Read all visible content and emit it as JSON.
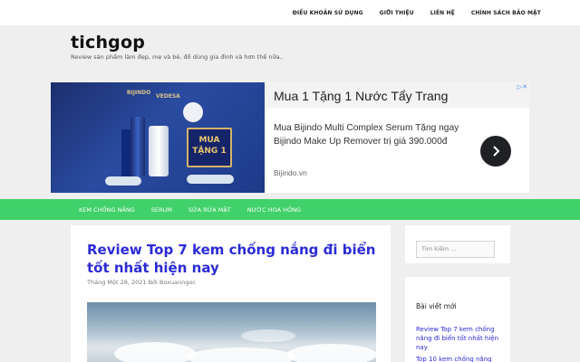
{
  "topbar": {
    "links": [
      "ĐIỀU KHOẢN SỬ DỤNG",
      "GIỚI THIỆU",
      "LIÊN HỆ",
      "CHÍNH SÁCH BẢO MẬT"
    ]
  },
  "site": {
    "title": "tichgop",
    "description": "Review sản phẩm làm đẹp, mẹ và bé, đồ dùng gia đình và hơn thế nữa.."
  },
  "ad": {
    "image_brand_left": "BIJINDO",
    "image_brand_right": "VEDESA",
    "image_promo": "MUA TẶNG 1",
    "headline": "Mua 1 Tặng 1 Nước Tẩy Trang",
    "body": "Mua Bijindo Multi Complex Serum Tặng ngay Bijindo Make Up Remover trị giá 390.000đ",
    "source": "Bijindo.vn",
    "next_icon": "chevron-right-icon",
    "close_icon": "adchoices-close-icon"
  },
  "nav": {
    "items": [
      "KEM CHỐNG NẮNG",
      "SERUM",
      "SỮA RỬA MẶT",
      "NƯỚC HOA HỒNG"
    ]
  },
  "article": {
    "title": "Review Top 7 kem chống nắng đi biển tốt nhất hiện nay",
    "meta": "Tháng Một 28, 2021 Bởi Boxuanngoc"
  },
  "sidebar": {
    "search_placeholder": "Tìm kiếm ...",
    "recent_title": "Bài viết mới",
    "recent_posts": [
      "Review Top 7 kem chống nắng đi biển tốt nhất hiện nay",
      "Top 10 kem chống nắng"
    ]
  },
  "colors": {
    "nav_bg": "#41d16a",
    "link": "#2b2bd6",
    "page_bg": "#efefef"
  }
}
